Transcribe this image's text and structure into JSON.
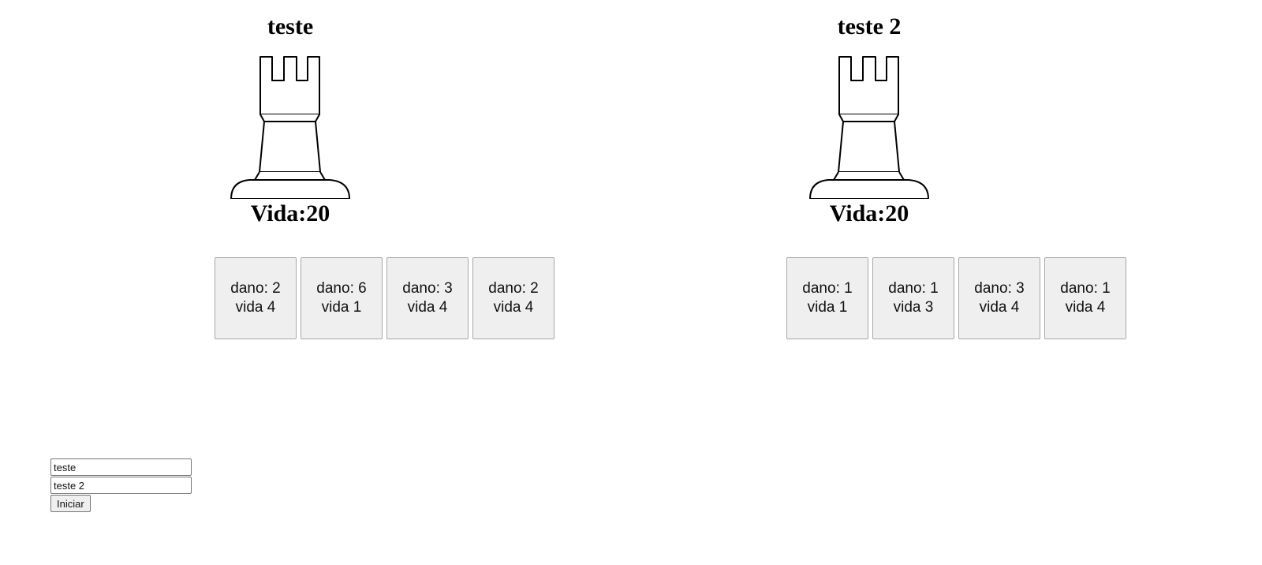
{
  "players": [
    {
      "name": "teste",
      "life_label": "Vida:",
      "life_value": "20",
      "piece_icon": "rook-icon",
      "cards": [
        {
          "dano": "dano: 2",
          "vida": "vida 4"
        },
        {
          "dano": "dano: 6",
          "vida": "vida 1"
        },
        {
          "dano": "dano: 3",
          "vida": "vida 4"
        },
        {
          "dano": "dano: 2",
          "vida": "vida 4"
        }
      ]
    },
    {
      "name": "teste 2",
      "life_label": "Vida:",
      "life_value": "20",
      "piece_icon": "rook-icon",
      "cards": [
        {
          "dano": "dano: 1",
          "vida": "vida 1"
        },
        {
          "dano": "dano: 1",
          "vida": "vida 3"
        },
        {
          "dano": "dano: 3",
          "vida": "vida 4"
        },
        {
          "dano": "dano: 1",
          "vida": "vida 4"
        }
      ]
    }
  ],
  "setup": {
    "player1_value": "teste",
    "player2_value": "teste 2",
    "start_label": "Iniciar"
  }
}
